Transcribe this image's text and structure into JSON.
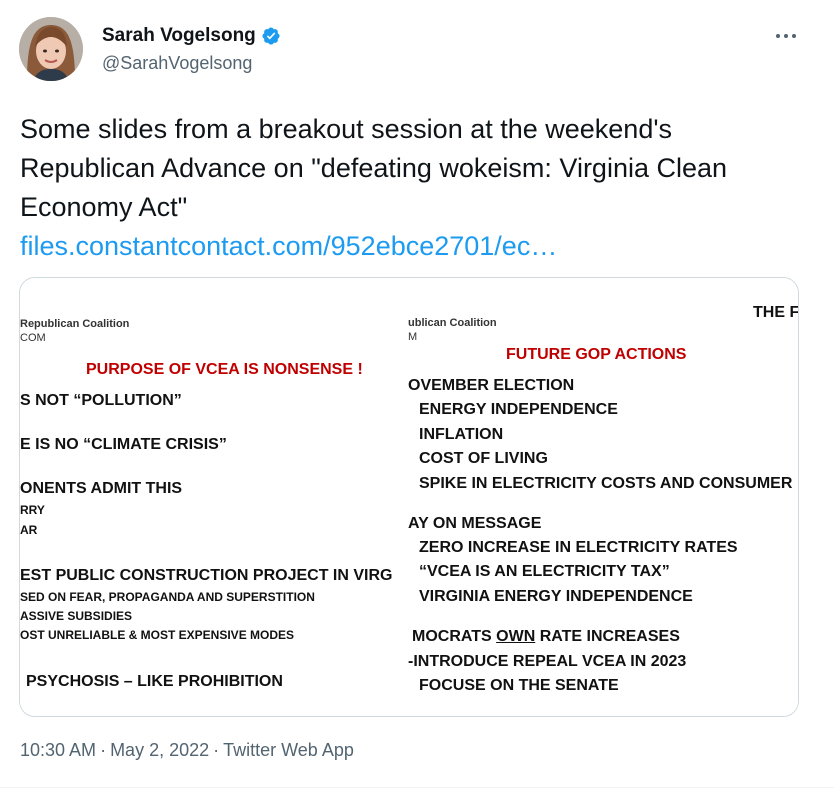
{
  "author": {
    "display_name": "Sarah Vogelsong",
    "handle": "@SarahVogelsong",
    "verified_icon": "verified-badge-icon",
    "verified_color": "#1d9bf0"
  },
  "more_icon": "more-horizontal-icon",
  "tweet": {
    "text": "Some slides from a breakout session at the weekend's Republican Advance on \"defeating wokeism: Virginia Clean Economy Act\"",
    "link": "files.constantcontact.com/952ebce2701/ec…"
  },
  "slides": {
    "left": {
      "org": "Republican Coalition",
      "org2": "COM",
      "title": "PURPOSE OF VCEA IS NONSENSE !",
      "lines": [
        "S NOT “POLLUTION”",
        "E IS NO “CLIMATE CRISIS”",
        "ONENTS ADMIT THIS",
        "EST PUBLIC CONSTRUCTION PROJECT IN VIRG",
        "PSYCHOSIS – LIKE PROHIBITION"
      ],
      "subs": [
        "RRY",
        "AR",
        "SED ON FEAR, PROPAGANDA AND SUPERSTITION",
        "ASSIVE SUBSIDIES",
        "OST UNRELIABLE & MOST EXPENSIVE MODES"
      ]
    },
    "right": {
      "org": "ublican Coalition",
      "org2": "M",
      "corner": "THE F",
      "title": "FUTURE GOP ACTIONS",
      "lines": [
        "OVEMBER ELECTION",
        "ENERGY INDEPENDENCE",
        "INFLATION",
        "COST OF LIVING",
        "SPIKE IN ELECTRICITY COSTS AND CONSUMER",
        "AY ON MESSAGE",
        "ZERO INCREASE IN ELECTRICITY RATES",
        "“VCEA IS AN ELECTRICITY TAX”",
        "VIRGINIA ENERGY INDEPENDENCE",
        "MOCRATS ",
        "OWN",
        " RATE INCREASES",
        "-INTRODUCE REPEAL VCEA  IN 2023",
        "FOCUSE ON THE SENATE"
      ]
    }
  },
  "meta": {
    "time": "10:30 AM",
    "date": "May 2, 2022",
    "source": "Twitter Web App",
    "separator": "·"
  }
}
